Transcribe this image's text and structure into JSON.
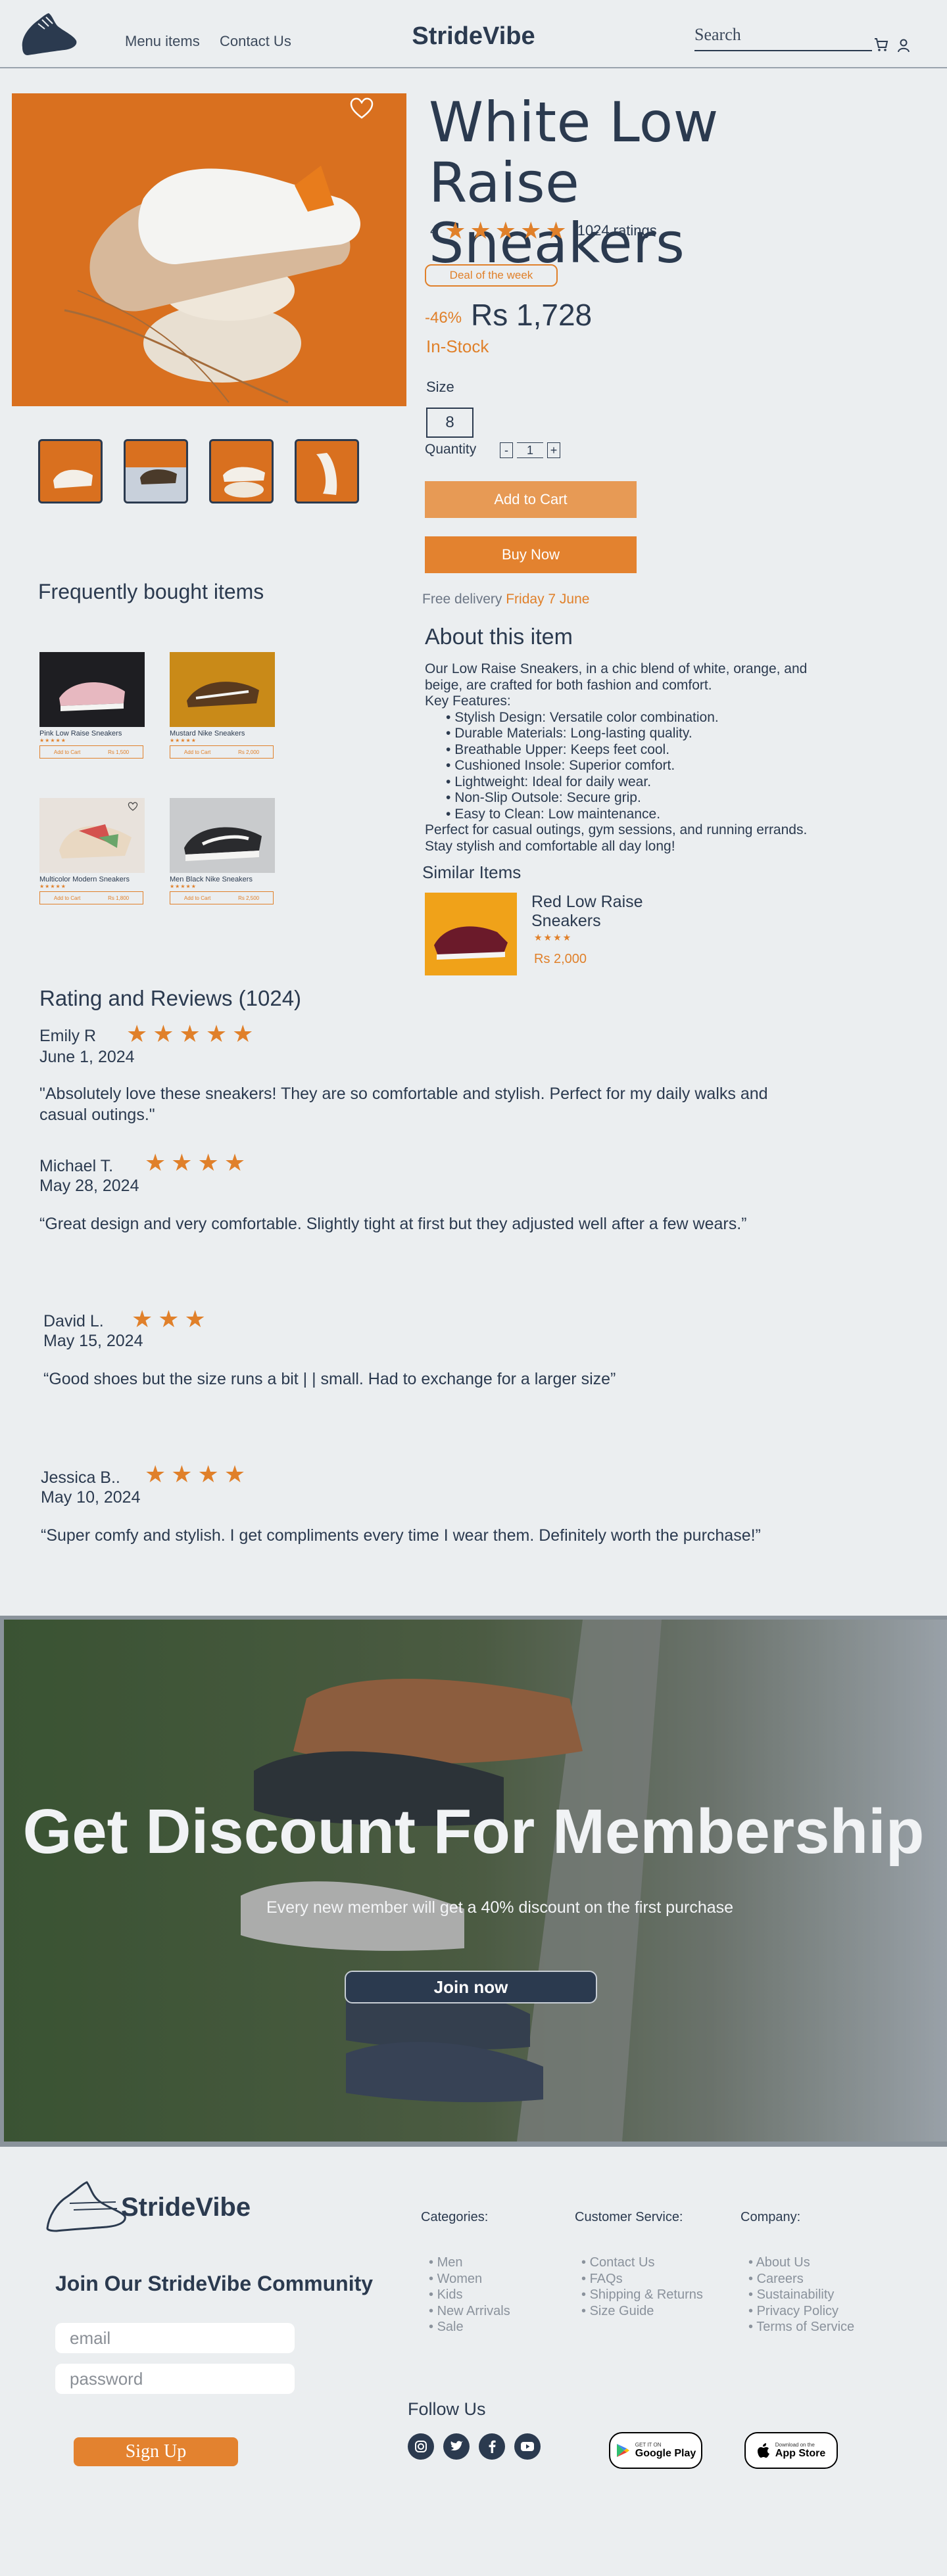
{
  "header": {
    "brand": "StrideVibe",
    "nav": [
      "Menu items",
      "Contact Us"
    ],
    "search_placeholder": "Search"
  },
  "product": {
    "title_line1": "White Low",
    "title_line2": "Raise Sneakers",
    "rating_value": "4",
    "ratings_count": "1024 ratings",
    "deal_badge": "Deal of the week",
    "discount": "-46%",
    "price": "Rs 1,728",
    "stock": "In-Stock",
    "size_label": "Size",
    "size_value": "8",
    "quantity_label": "Quantity",
    "quantity_minus": "-",
    "quantity_value": "1",
    "quantity_plus": "+",
    "add_to_cart": "Add to Cart",
    "buy_now": "Buy Now",
    "delivery_prefix": "Free delivery",
    "delivery_date": "Friday 7 June"
  },
  "about": {
    "title": "About this item",
    "intro": "Our Low Raise Sneakers, in a chic blend of white, orange, and beige, are crafted for both fashion and comfort.",
    "features_heading": "Key Features:",
    "features": [
      "Stylish Design: Versatile color combination.",
      "Durable Materials: Long-lasting quality.",
      "Breathable Upper: Keeps feet cool.",
      "Cushioned Insole: Superior comfort.",
      "Lightweight: Ideal for daily wear.",
      "Non-Slip Outsole: Secure grip.",
      "Easy to Clean: Low maintenance."
    ],
    "outro": "Perfect for casual outings, gym sessions, and running errands. Stay stylish and comfortable all day long!"
  },
  "similar": {
    "title": "Similar Items",
    "name": "Red Low Raise Sneakers",
    "stars": "★★★★",
    "price": "Rs 2,000"
  },
  "frequently_bought": {
    "title": "Frequently bought items",
    "items": [
      {
        "name": "Pink Low Raise Sneakers",
        "add": "Add to Cart",
        "price": "Rs 1,500"
      },
      {
        "name": "Mustard Nike Sneakers",
        "add": "Add to Cart",
        "price": "Rs 2,000"
      },
      {
        "name": "Multicolor Modern Sneakers",
        "add": "Add to Cart",
        "price": "Rs 1,800"
      },
      {
        "name": "Men Black Nike Sneakers",
        "add": "Add to Cart",
        "price": "Rs 2,500"
      }
    ],
    "stars": "★★★★★"
  },
  "reviews": {
    "title": "Rating and Reviews (1024)",
    "items": [
      {
        "name": "Emily R",
        "stars": "★★★★★",
        "date": "June 1, 2024",
        "text": "\"Absolutely love these sneakers! They are so comfortable and stylish. Perfect for my daily walks and casual outings.\""
      },
      {
        "name": "Michael T.",
        "stars": "★★★★",
        "date": "May 28, 2024",
        "text": "“Great design and very comfortable. Slightly tight at first but they adjusted well after a few wears.”"
      },
      {
        "name": "David L.",
        "stars": "★★★",
        "date": "May 15, 2024",
        "text": "“Good shoes but the size runs a bit | |  small. Had to exchange for a larger size”"
      },
      {
        "name": "Jessica B..",
        "stars": "★★★★",
        "date": "May 10, 2024",
        "text": "“Super comfy and stylish. I get compliments every time I wear them. Definitely worth the purchase!”"
      }
    ]
  },
  "banner": {
    "title": "Get Discount For Membership",
    "subtitle": "Every new member will get a 40% discount on the first purchase",
    "button": "Join now"
  },
  "footer": {
    "brand": "StrideVibe",
    "community": "Join Our StrideVibe Community",
    "email_placeholder": "email",
    "password_placeholder": "password",
    "signup": "Sign Up",
    "categories": {
      "title": "Categories:",
      "items": [
        "Men",
        "Women",
        "Kids",
        "New Arrivals",
        "Sale"
      ]
    },
    "customer_service": {
      "title": "Customer Service:",
      "items": [
        "Contact Us",
        "FAQs",
        "Shipping & Returns",
        "Size Guide"
      ]
    },
    "company": {
      "title": "Company:",
      "items": [
        "About Us",
        "Careers",
        "Sustainability",
        "Privacy Policy",
        "Terms of Service"
      ]
    },
    "follow": "Follow Us",
    "google_small": "GET IT ON",
    "google_big": "Google Play",
    "apple_small": "Download on the",
    "apple_big": "App Store"
  },
  "colors": {
    "accent": "#e3822f",
    "text": "#2b3a4f",
    "background": "#ebeef0"
  }
}
